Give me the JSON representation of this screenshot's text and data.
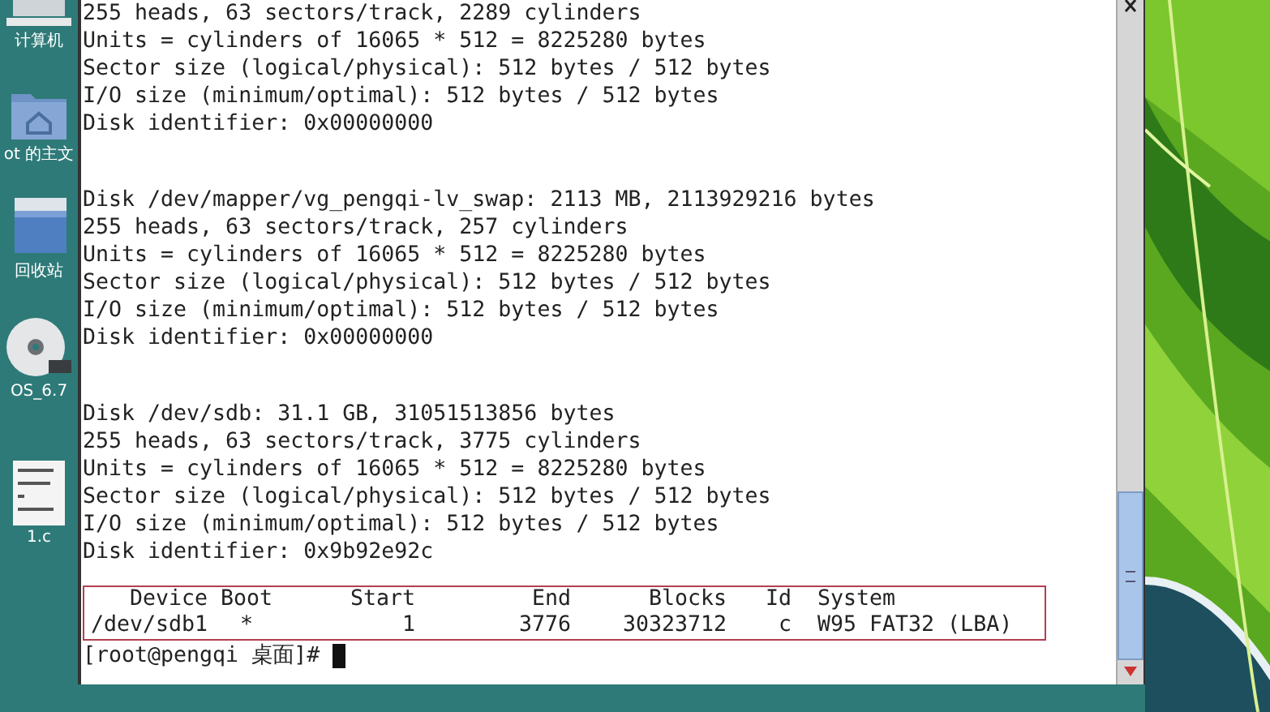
{
  "desktop_icons": [
    {
      "kind": "computer",
      "label": "计算机"
    },
    {
      "kind": "home",
      "label": "ot 的主文"
    },
    {
      "kind": "trash",
      "label": "回收站"
    },
    {
      "kind": "disc",
      "label": "OS_6.7"
    },
    {
      "kind": "file",
      "label": "1.c"
    }
  ],
  "terminal": {
    "output_groups": [
      {
        "lines": [
          "255 heads, 63 sectors/track, 2289 cylinders",
          "Units = cylinders of 16065 * 512 = 8225280 bytes",
          "Sector size (logical/physical): 512 bytes / 512 bytes",
          "I/O size (minimum/optimal): 512 bytes / 512 bytes",
          "Disk identifier: 0x00000000"
        ]
      },
      {
        "lines": [
          "Disk /dev/mapper/vg_pengqi-lv_swap: 2113 MB, 2113929216 bytes",
          "255 heads, 63 sectors/track, 257 cylinders",
          "Units = cylinders of 16065 * 512 = 8225280 bytes",
          "Sector size (logical/physical): 512 bytes / 512 bytes",
          "I/O size (minimum/optimal): 512 bytes / 512 bytes",
          "Disk identifier: 0x00000000"
        ]
      },
      {
        "lines": [
          "Disk /dev/sdb: 31.1 GB, 31051513856 bytes",
          "255 heads, 63 sectors/track, 3775 cylinders",
          "Units = cylinders of 16065 * 512 = 8225280 bytes",
          "Sector size (logical/physical): 512 bytes / 512 bytes",
          "I/O size (minimum/optimal): 512 bytes / 512 bytes",
          "Disk identifier: 0x9b92e92c"
        ]
      }
    ],
    "partition_table": {
      "columns": [
        "Device",
        "Boot",
        "Start",
        "End",
        "Blocks",
        "Id",
        "System"
      ],
      "rows": [
        [
          "/dev/sdb1",
          "*",
          "1",
          "3776",
          "30323712",
          "c",
          "W95 FAT32 (LBA)"
        ]
      ]
    },
    "prompt": "[root@pengqi 桌面]#"
  }
}
